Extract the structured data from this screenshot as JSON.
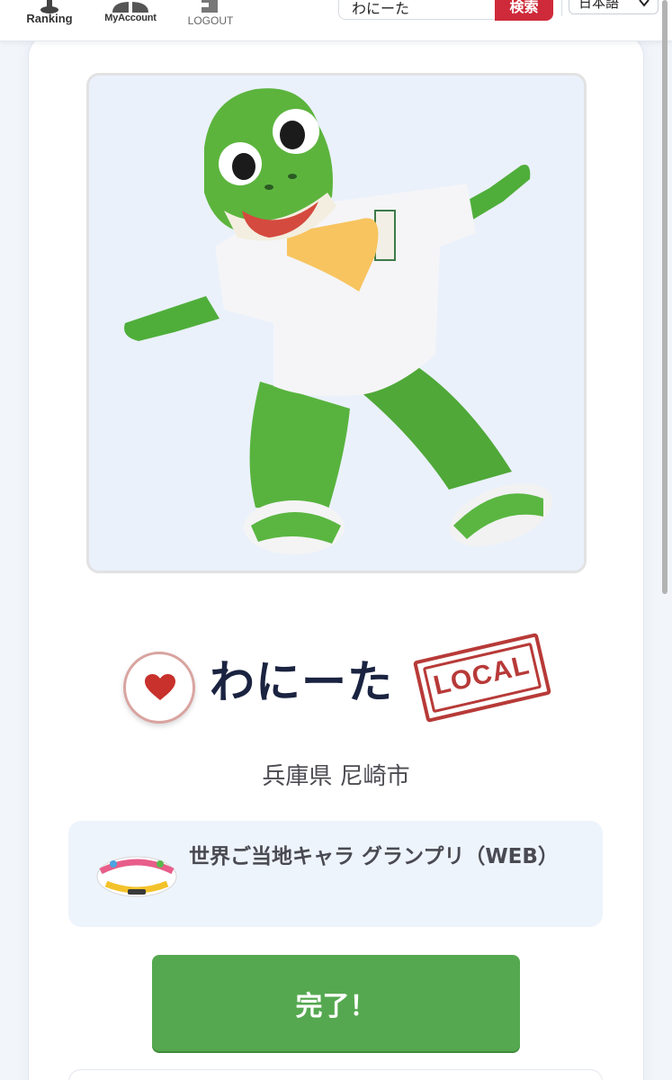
{
  "nav": {
    "items": [
      {
        "label": "Ranking",
        "icon": "ranking-icon"
      },
      {
        "label": "MyAccount",
        "icon": "account-icon"
      },
      {
        "label": "LOGOUT",
        "icon": "logout-icon"
      }
    ]
  },
  "search": {
    "value": "わにーた",
    "button_label": "検索"
  },
  "language": {
    "selected": "日本語"
  },
  "character": {
    "name": "わにーた",
    "badge": "LOCAL",
    "location": "兵庫県 尼崎市",
    "favorite_icon": "heart-icon"
  },
  "event": {
    "title": "世界ご当地キャラ グランプリ（WEB）",
    "logo_text": "世界ご当地キャラ グランプリ"
  },
  "actions": {
    "done_label": "完了！"
  },
  "colors": {
    "accent_red": "#cf2a3a",
    "done_green": "#55a84f",
    "stamp_red": "#b73a38",
    "heart_red": "#c8312c"
  }
}
